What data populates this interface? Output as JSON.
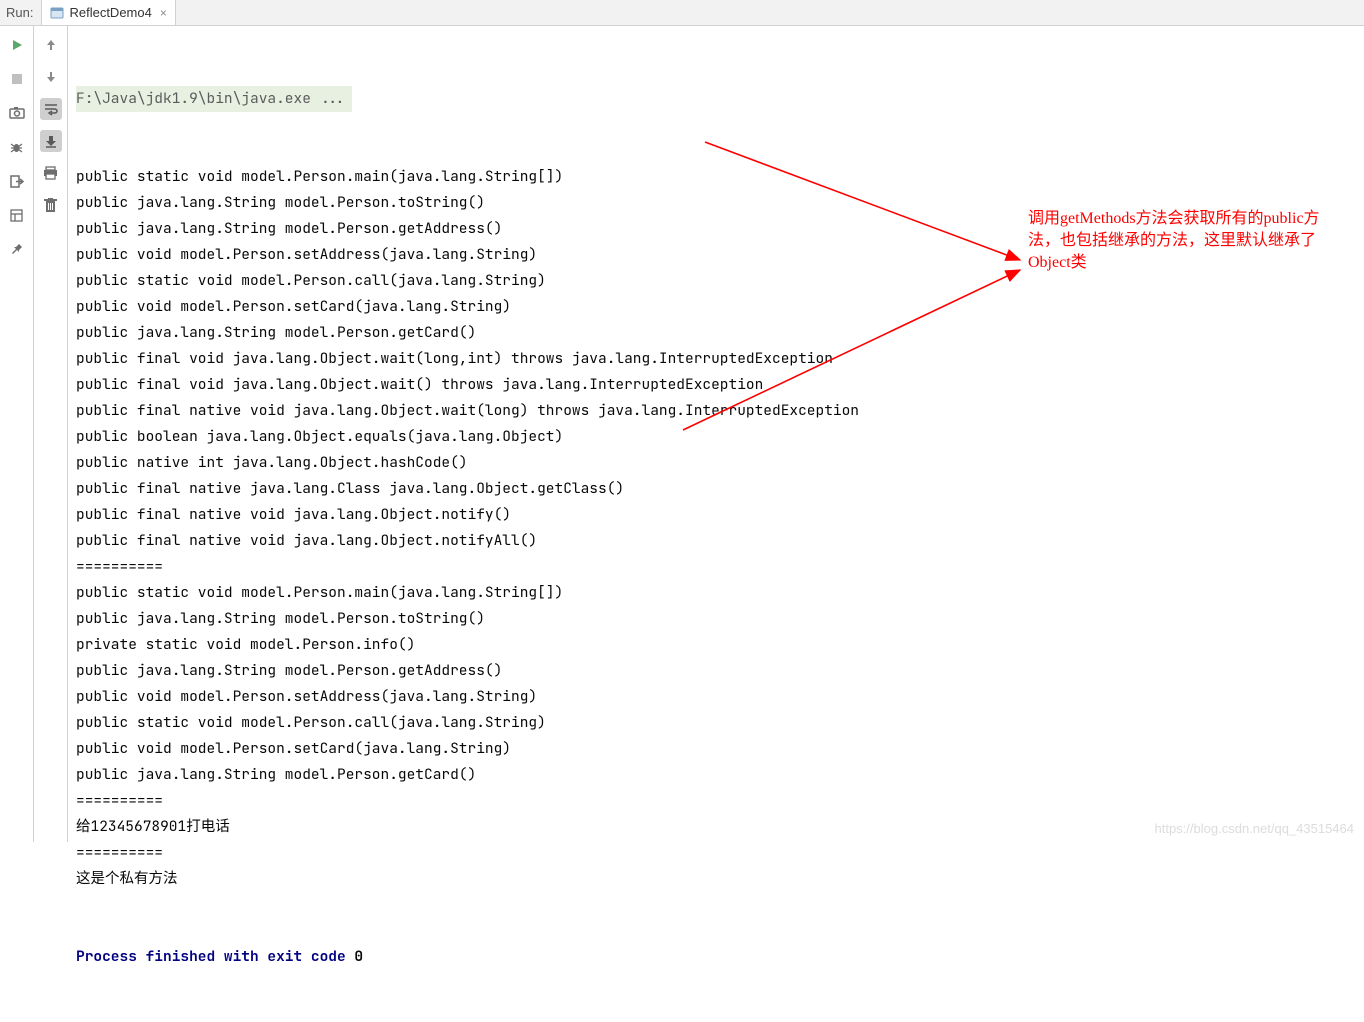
{
  "header": {
    "run_label": "Run:",
    "tab_name": "ReflectDemo4"
  },
  "toolbar_left": {
    "items": [
      {
        "name": "run-icon"
      },
      {
        "name": "stop-icon"
      },
      {
        "name": "camera-icon"
      },
      {
        "name": "bug-icon"
      },
      {
        "name": "exit-icon"
      },
      {
        "name": "layout-icon"
      },
      {
        "name": "pin-icon"
      }
    ]
  },
  "toolbar_right": {
    "items": [
      {
        "name": "up-arrow-icon"
      },
      {
        "name": "down-arrow-icon"
      },
      {
        "name": "wrap-icon",
        "selected": true
      },
      {
        "name": "scroll-end-icon",
        "selected": true
      },
      {
        "name": "print-icon"
      },
      {
        "name": "trash-icon"
      }
    ]
  },
  "console": {
    "command": "F:\\Java\\jdk1.9\\bin\\java.exe ...",
    "lines": [
      "public static void model.Person.main(java.lang.String[])",
      "public java.lang.String model.Person.toString()",
      "public java.lang.String model.Person.getAddress()",
      "public void model.Person.setAddress(java.lang.String)",
      "public static void model.Person.call(java.lang.String)",
      "public void model.Person.setCard(java.lang.String)",
      "public java.lang.String model.Person.getCard()",
      "public final void java.lang.Object.wait(long,int) throws java.lang.InterruptedException",
      "public final void java.lang.Object.wait() throws java.lang.InterruptedException",
      "public final native void java.lang.Object.wait(long) throws java.lang.InterruptedException",
      "public boolean java.lang.Object.equals(java.lang.Object)",
      "public native int java.lang.Object.hashCode()",
      "public final native java.lang.Class java.lang.Object.getClass()",
      "public final native void java.lang.Object.notify()",
      "public final native void java.lang.Object.notifyAll()",
      "==========",
      "public static void model.Person.main(java.lang.String[])",
      "public java.lang.String model.Person.toString()",
      "private static void model.Person.info()",
      "public java.lang.String model.Person.getAddress()",
      "public void model.Person.setAddress(java.lang.String)",
      "public static void model.Person.call(java.lang.String)",
      "public void model.Person.setCard(java.lang.String)",
      "public java.lang.String model.Person.getCard()",
      "==========",
      "给12345678901打电话",
      "==========",
      "这是个私有方法",
      ""
    ],
    "exit_line_prefix": "Process finished with exit code ",
    "exit_code": "0"
  },
  "annotation": {
    "text": "调用getMethods方法会获取所有的public方法，也包括继承的方法，这里默认继承了Object类"
  },
  "watermark": "https://blog.csdn.net/qq_43515464"
}
